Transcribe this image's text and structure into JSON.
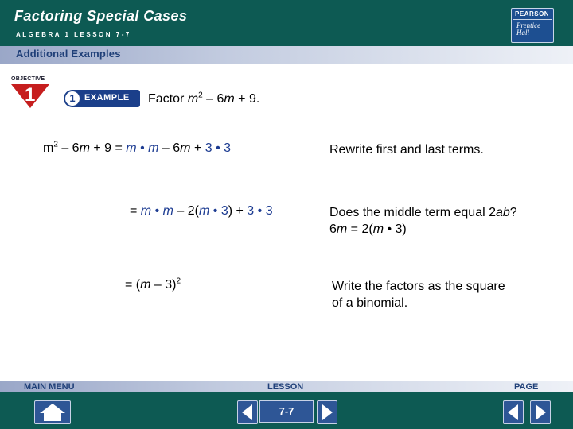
{
  "header": {
    "title": "Factoring Special Cases",
    "subtitle": "ALGEBRA 1  LESSON 7-7",
    "logo": {
      "top_text": "PEARSON",
      "line1": "Prentice",
      "line2": "Hall"
    }
  },
  "section_bar": {
    "label": "Additional Examples"
  },
  "objective": {
    "label": "OBJECTIVE",
    "number": "1"
  },
  "example": {
    "number": "1",
    "label": "EXAMPLE"
  },
  "problem": {
    "prefix": "Factor ",
    "var": "m",
    "exp": "2",
    "rest_a": " – 6",
    "var2": "m",
    "rest_b": " + 9."
  },
  "steps": [
    {
      "lhs": "m2 – 6m + 9",
      "rhs": "= m • m – 6m + 3 • 3",
      "note": "Rewrite first and last terms."
    },
    {
      "rhs": "= m • m – 2(m • 3) + 3 • 3",
      "note_line1": "Does the middle term equal 2ab?",
      "note_line2": "6m = 2(m • 3)"
    },
    {
      "rhs": "= (m – 3)2",
      "note_line1": "Write the factors as the square",
      "note_line2": "of a binomial."
    }
  ],
  "footer": {
    "main_menu": "MAIN MENU",
    "lesson": "LESSON",
    "page": "PAGE",
    "lesson_number": "7-7",
    "icons": [
      "home-icon",
      "previous-lesson-icon",
      "next-lesson-icon",
      "previous-page-icon",
      "next-page-icon"
    ]
  },
  "colors": {
    "header_bg": "#0d5a53",
    "accent_blue": "#1d3c92",
    "objective_red": "#c61e1e"
  }
}
